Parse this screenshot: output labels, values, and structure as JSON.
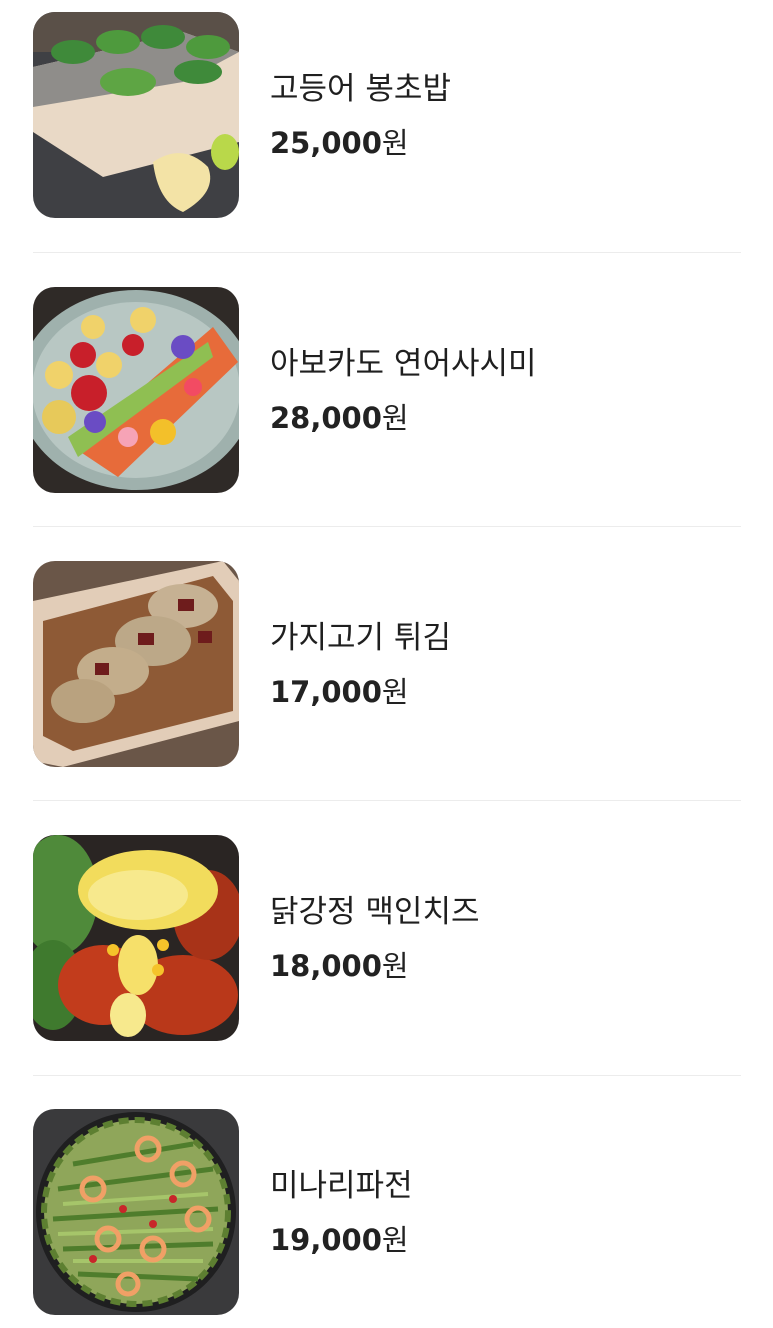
{
  "menu": {
    "currency_suffix": "원",
    "items": [
      {
        "name": "고등어 봉초밥",
        "price": "25,000",
        "photo": "mackerel-sushi-photo"
      },
      {
        "name": "아보카도 연어사시미",
        "price": "28,000",
        "photo": "avocado-salmon-sashimi-photo"
      },
      {
        "name": "가지고기 튀김",
        "price": "17,000",
        "photo": "eggplant-meat-fritter-photo"
      },
      {
        "name": "닭강정 맥인치즈",
        "price": "18,000",
        "photo": "sweet-crispy-chicken-mac-cheese-photo"
      },
      {
        "name": "미나리파전",
        "price": "19,000",
        "photo": "water-parsley-pancake-photo"
      }
    ]
  }
}
